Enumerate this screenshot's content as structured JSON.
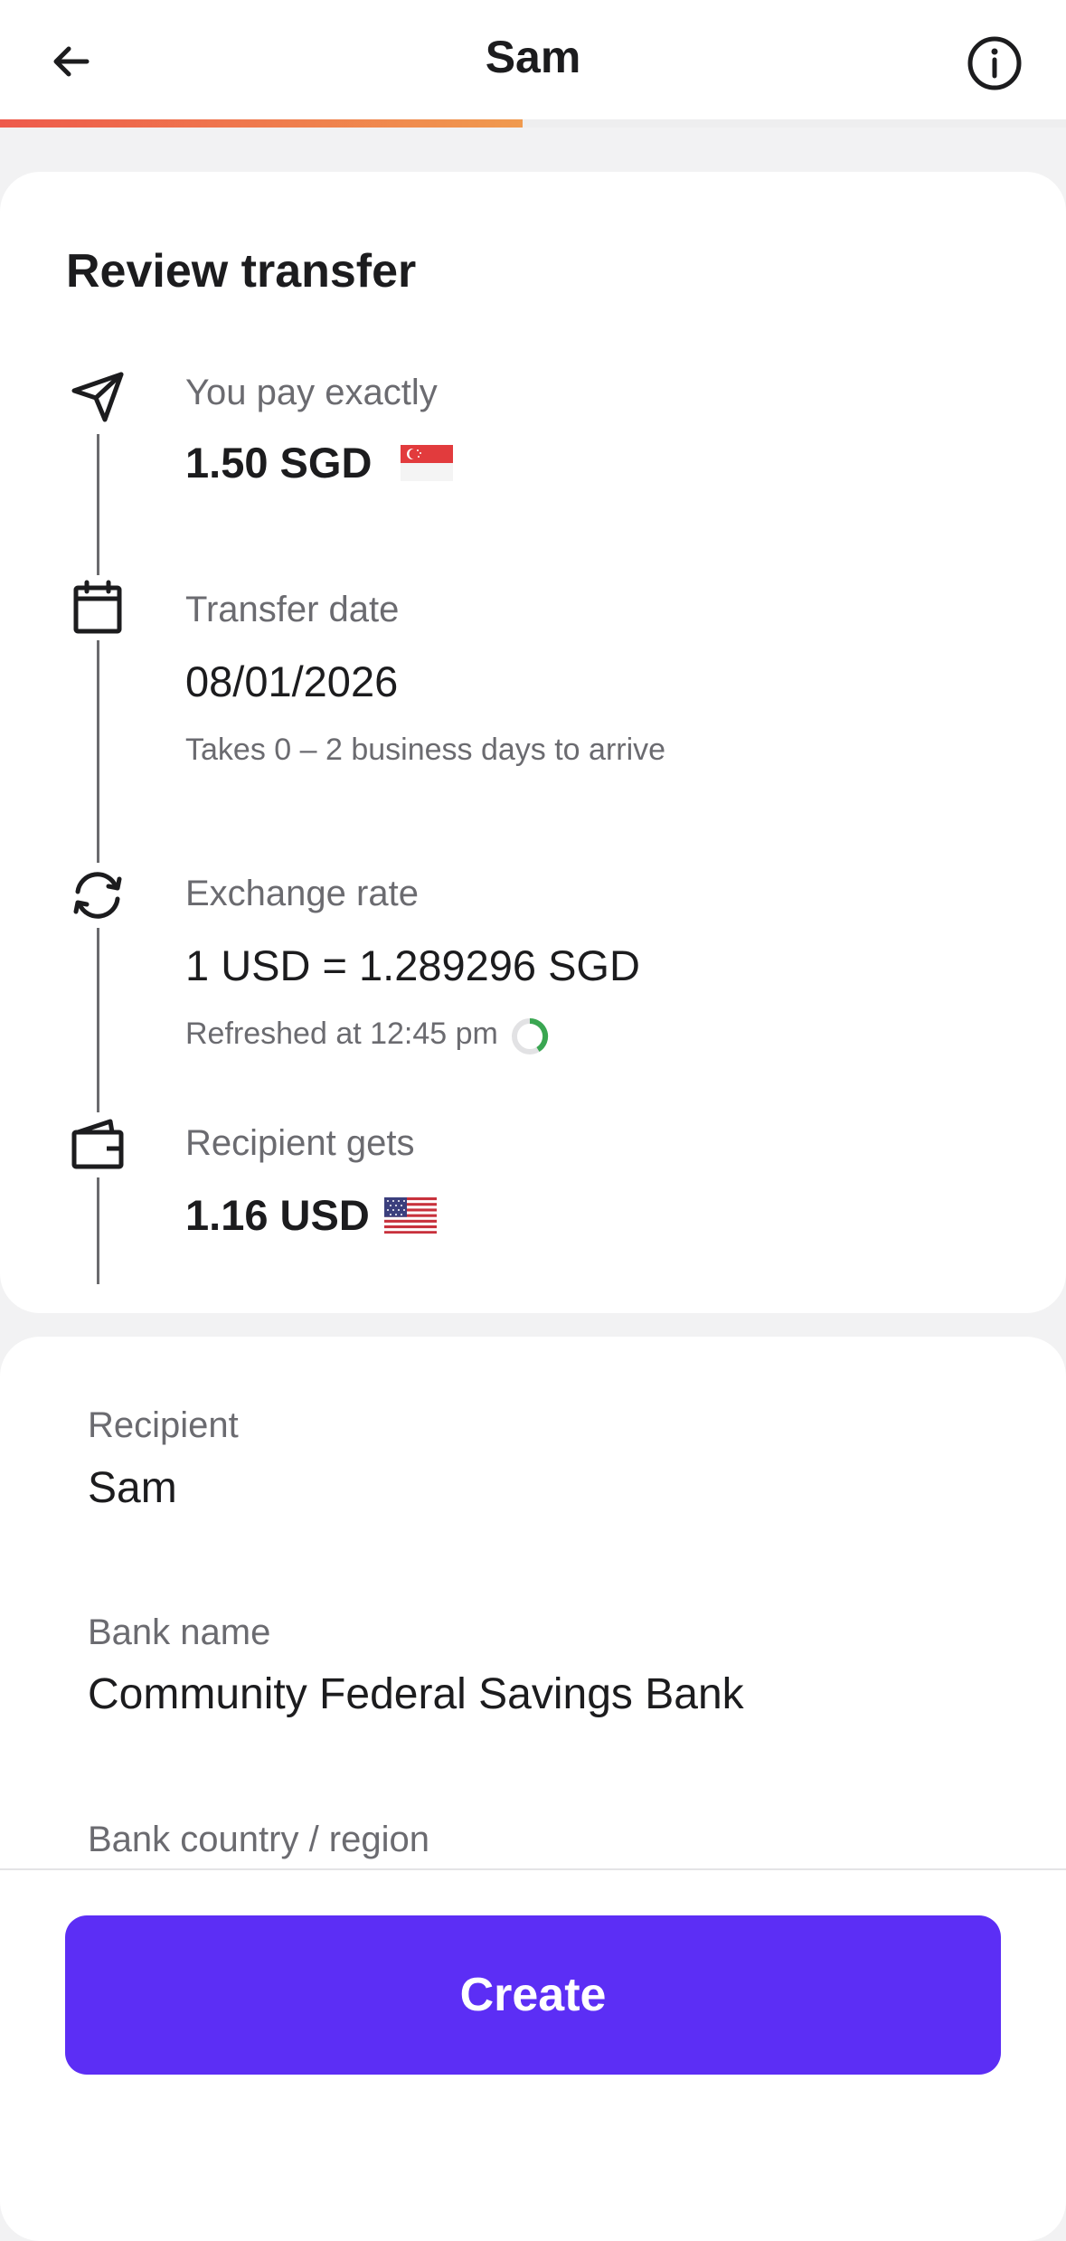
{
  "header": {
    "title": "Sam",
    "back_icon": "arrow-left-icon",
    "info_icon": "info-icon",
    "progress": 0.49,
    "progress_colors": [
      "#ee5a4c",
      "#f09a4e"
    ]
  },
  "review": {
    "title": "Review transfer",
    "steps": [
      {
        "icon": "paper-plane-icon",
        "label": "You pay exactly",
        "value": "1.50 SGD",
        "flag": "singapore-flag-icon"
      },
      {
        "icon": "calendar-icon",
        "label": "Transfer date",
        "value": "08/01/2026",
        "note": "Takes 0 – 2 business days to arrive"
      },
      {
        "icon": "refresh-icon",
        "label": "Exchange rate",
        "value": "1 USD = 1.289296 SGD",
        "note": "Refreshed at 12:45 pm",
        "note_icon": "countdown-ring-icon"
      },
      {
        "icon": "wallet-icon",
        "label": "Recipient gets",
        "value": "1.16 USD",
        "flag": "us-flag-icon"
      }
    ]
  },
  "details": {
    "recipient_label": "Recipient",
    "recipient_value": "Sam",
    "bank_name_label": "Bank name",
    "bank_name_value": "Community Federal Savings Bank",
    "bank_country_label": "Bank country / region"
  },
  "footer": {
    "create_label": "Create",
    "accent": "#5c2ef5"
  }
}
